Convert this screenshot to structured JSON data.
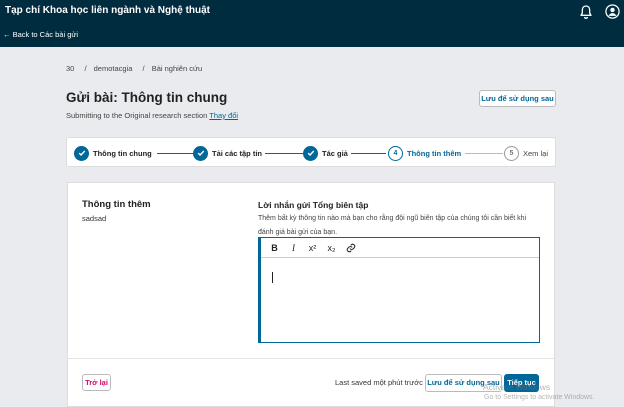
{
  "header": {
    "journal_title": "Tạp chí Khoa học liên ngành và Nghệ thuật",
    "back_label": "← Back to Các bài gửi",
    "icons": [
      "bell-icon",
      "user-icon"
    ]
  },
  "breadcrumb": {
    "items": [
      "30",
      "demotacgia",
      "Bài nghiên cứu"
    ],
    "separator": "/"
  },
  "page": {
    "title": "Gửi bài: Thông tin chung",
    "subtitle_prefix": "Submitting to the Original research section",
    "change_link": "Thay đổi",
    "save_later_label": "Lưu để sử dụng sau"
  },
  "steps": [
    {
      "number": "1",
      "label": "Thông tin chung",
      "state": "done"
    },
    {
      "number": "2",
      "label": "Tải các tập tin",
      "state": "done"
    },
    {
      "number": "3",
      "label": "Tác giả",
      "state": "done"
    },
    {
      "number": "4",
      "label": "Thông tin thêm",
      "state": "current"
    },
    {
      "number": "5",
      "label": "Xem lại",
      "state": "todo"
    }
  ],
  "info_section": {
    "title": "Thông tin thêm",
    "value": "sadsad"
  },
  "editor_field": {
    "label": "Lời nhắn gửi Tổng biên tập",
    "description": "Thêm bất kỳ thông tin nào mà bạn cho rằng đội ngũ biên tập của chúng tôi cần biết khi đánh giá bài gửi của bạn.",
    "toolbar": {
      "bold": "B",
      "italic": "I",
      "superscript": "x²",
      "subscript": "x₂"
    },
    "value": ""
  },
  "footer": {
    "back_label": "Trở lại",
    "last_saved": "Last saved một phút trước",
    "save_later_label": "Lưu để sử dụng sau",
    "continue_label": "Tiếp tục"
  },
  "watermark": {
    "line1": "Activate Windows",
    "line2": "Go to Settings to activate Windows."
  },
  "colors": {
    "topbar": "#002c40",
    "primary": "#006798",
    "danger": "#d00a6c",
    "background": "#e9ebee"
  }
}
